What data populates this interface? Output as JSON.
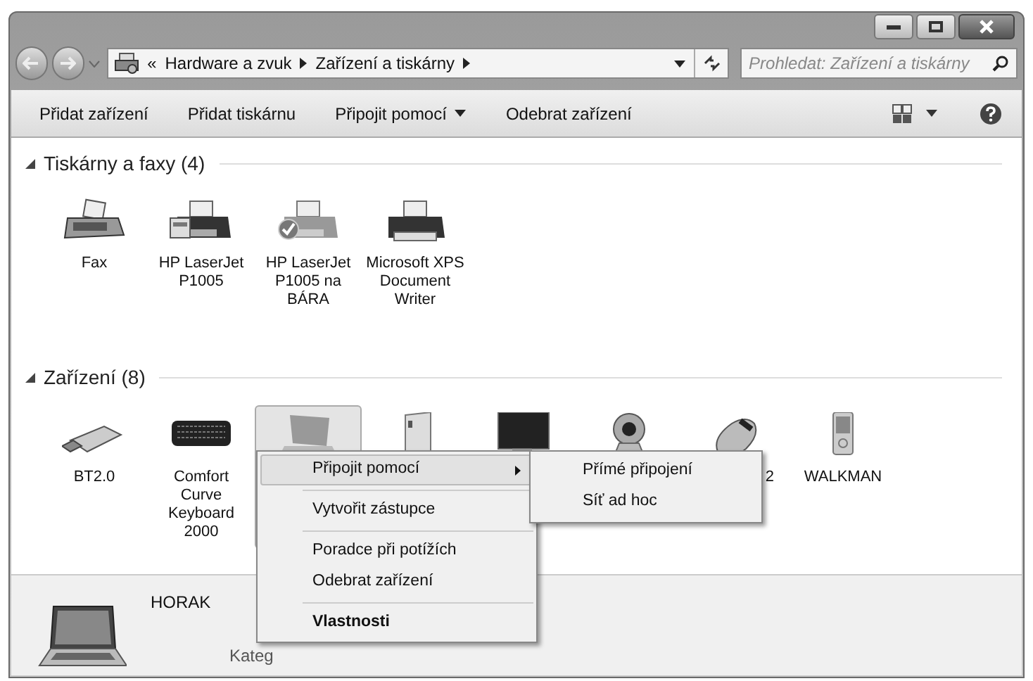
{
  "breadcrumb": {
    "overflow": "«",
    "items": [
      "Hardware a zvuk",
      "Zařízení a tiskárny"
    ]
  },
  "search": {
    "placeholder": "Prohledat: Zařízení a tiskárny"
  },
  "toolbar": [
    {
      "label": "Přidat zařízení",
      "dropdown": false
    },
    {
      "label": "Přidat tiskárnu",
      "dropdown": false
    },
    {
      "label": "Připojit pomocí",
      "dropdown": true
    },
    {
      "label": "Odebrat zařízení",
      "dropdown": false
    }
  ],
  "sections": [
    {
      "title": "Tiskárny a faxy (4)",
      "expanded": true,
      "items": [
        {
          "kind": "fax",
          "label": "Fax",
          "selected": false
        },
        {
          "kind": "printer-queue",
          "label": "HP LaserJet P1005",
          "selected": false
        },
        {
          "kind": "printer-default",
          "label": "HP LaserJet P1005 na BÁRA",
          "selected": false
        },
        {
          "kind": "printer-xps",
          "label": "Microsoft XPS Document Writer",
          "selected": false
        }
      ]
    },
    {
      "title": "Zařízení (8)",
      "expanded": true,
      "items": [
        {
          "kind": "usb",
          "label": "BT2.0",
          "selected": false
        },
        {
          "kind": "keyboard",
          "label": "Comfort Curve Keyboard 2000",
          "selected": false
        },
        {
          "kind": "laptop",
          "selected": true
        },
        {
          "kind": "drive",
          "selected": false
        },
        {
          "kind": "monitor",
          "selected": false
        },
        {
          "kind": "webcam",
          "selected": false
        },
        {
          "kind": "mouse",
          "label": "2",
          "label_tail_only": true,
          "selected": false
        },
        {
          "kind": "player",
          "label": "WALKMAN",
          "selected": false
        }
      ]
    }
  ],
  "details": {
    "name": "HORAK",
    "category": "Kateg"
  },
  "context_menu": [
    {
      "kind": "item",
      "label": "Připojit pomocí",
      "submenu": true,
      "selected": true,
      "default": false
    },
    {
      "kind": "separator"
    },
    {
      "kind": "item",
      "label": "Vytvořit zástupce",
      "submenu": false,
      "selected": false,
      "default": false
    },
    {
      "kind": "separator"
    },
    {
      "kind": "item",
      "label": "Poradce při potížích",
      "submenu": false,
      "selected": false,
      "default": false
    },
    {
      "kind": "item",
      "label": "Odebrat zařízení",
      "submenu": false,
      "selected": false,
      "default": false
    },
    {
      "kind": "separator"
    },
    {
      "kind": "item",
      "label": "Vlastnosti",
      "submenu": false,
      "selected": false,
      "default": true
    }
  ],
  "submenu": [
    {
      "label": "Přímé připojení",
      "selected": false
    },
    {
      "label": "Síť ad hoc",
      "selected": false
    }
  ]
}
